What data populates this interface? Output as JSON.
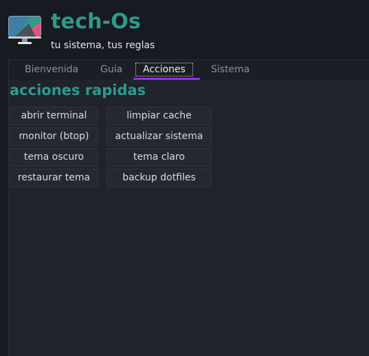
{
  "app": {
    "title": "tech-Os",
    "subtitle": "tu sistema, tus reglas",
    "logo_icon": "monitor-icon"
  },
  "tabs": [
    {
      "label": "Bienvenida",
      "active": false
    },
    {
      "label": "Guia",
      "active": false
    },
    {
      "label": "Acciones",
      "active": true
    },
    {
      "label": "Sistema",
      "active": false
    }
  ],
  "section": {
    "title": "acciones rapidas"
  },
  "actions": [
    {
      "label": "abrir terminal"
    },
    {
      "label": "limpiar cache"
    },
    {
      "label": "monitor (btop)"
    },
    {
      "label": "actualizar sistema"
    },
    {
      "label": "tema oscuro"
    },
    {
      "label": "tema claro"
    },
    {
      "label": "restaurar tema"
    },
    {
      "label": "backup dotfiles"
    }
  ],
  "colors": {
    "accent": "#2e9a8c",
    "tab_indicator": "#9b30e6",
    "background": "#171a20",
    "panel": "#20232a",
    "button": "#252830"
  }
}
